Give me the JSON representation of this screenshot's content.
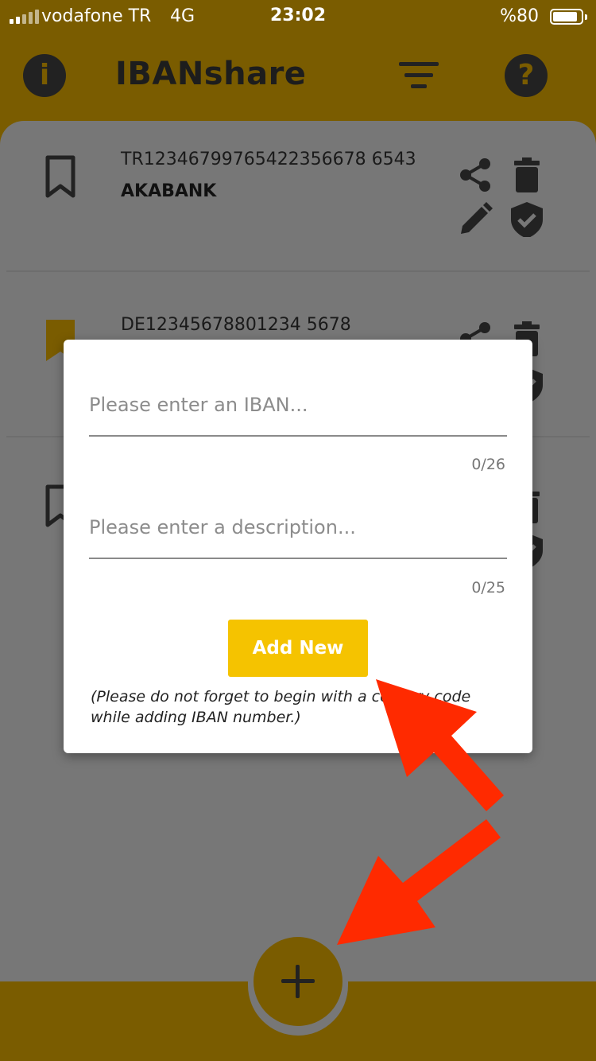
{
  "status_bar": {
    "carrier": "vodafone TR",
    "network": "4G",
    "time": "23:02",
    "battery": "%80"
  },
  "header": {
    "title": "IBANshare",
    "info_icon": "info-icon",
    "filter_icon": "filter-icon",
    "help_icon": "help-icon"
  },
  "list": {
    "items": [
      {
        "iban": "TR12346799765422356678 6543",
        "description": "AKABANK",
        "bookmarked": false
      },
      {
        "iban": "DE12345678801234 5678",
        "description": "",
        "bookmarked": true
      },
      {
        "iban": "",
        "description": "",
        "bookmarked": false
      }
    ]
  },
  "dialog": {
    "iban_placeholder": "Please enter an IBAN...",
    "iban_counter": "0/26",
    "description_placeholder": "Please enter a description...",
    "description_counter": "0/25",
    "add_button": "Add New",
    "note": "(Please do not forget to begin with a country code while adding IBAN number.)"
  },
  "colors": {
    "brand": "#7a5c00",
    "accent": "#f5c300",
    "annotation_arrow": "#ff2a00"
  }
}
